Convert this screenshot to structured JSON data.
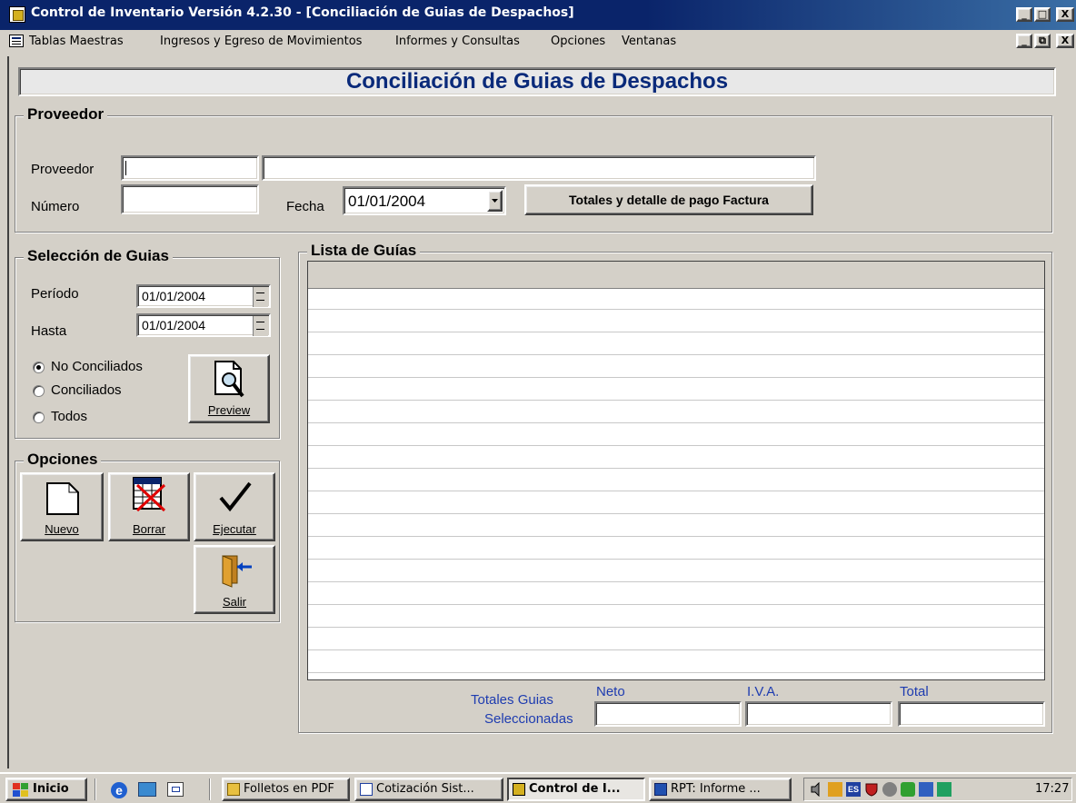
{
  "window": {
    "title": "Control de Inventario  Versión 4.2.30 - [Conciliación de Guias de Despachos]",
    "caption_buttons": [
      "_",
      "□",
      "X"
    ],
    "mdi_buttons": [
      "_",
      "⧉",
      "X"
    ]
  },
  "menu": {
    "items": [
      "Tablas Maestras",
      "Ingresos y Egreso de Movimientos",
      "Informes y Consultas",
      "Opciones",
      "Ventanas"
    ]
  },
  "header": {
    "title": "Conciliación de Guias de Despachos"
  },
  "proveedor": {
    "group_title": "Proveedor",
    "proveedor_label": "Proveedor",
    "proveedor_code": "",
    "proveedor_name": "",
    "numero_label": "Número",
    "numero_value": "",
    "fecha_label": "Fecha",
    "fecha_value": "01/01/2004",
    "totales_button": "Totales y detalle de  pago Factura"
  },
  "seleccion": {
    "group_title": "Selección de Guias",
    "periodo_label": "Período",
    "periodo_value": "01/01/2004",
    "hasta_label": "Hasta",
    "hasta_value": "01/01/2004",
    "radios": [
      {
        "label": "No Conciliados",
        "checked": true
      },
      {
        "label": "Conciliados",
        "checked": false
      },
      {
        "label": "Todos",
        "checked": false
      }
    ],
    "preview_button": "Preview"
  },
  "opciones": {
    "group_title": "Opciones",
    "nuevo": "Nuevo",
    "borrar": "Borrar",
    "ejecutar": "Ejecutar",
    "salir": "Salir"
  },
  "lista": {
    "group_title": "Lista de Guías",
    "rows": []
  },
  "totales": {
    "label_line1": "Totales Guias",
    "label_line2": "Seleccionadas",
    "neto_label": "Neto",
    "iva_label": "I.V.A.",
    "total_label": "Total",
    "neto": "",
    "iva": "",
    "total": ""
  },
  "taskbar": {
    "start": "Inicio",
    "tasks": [
      "Folletos en PDF",
      "Cotización Sist...",
      "Control de I...",
      "RPT: Informe ..."
    ],
    "clock": "17:27"
  }
}
